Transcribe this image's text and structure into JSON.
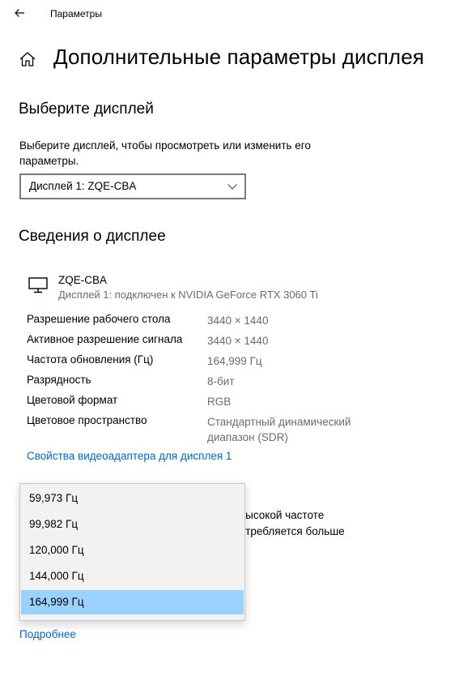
{
  "window": {
    "title": "Параметры"
  },
  "page": {
    "title": "Дополнительные параметры дисплея"
  },
  "select_display": {
    "heading": "Выберите дисплей",
    "description_line1": "Выберите дисплей, чтобы просмотреть или изменить его",
    "description_line2": "параметры.",
    "dropdown_value": "Дисплей 1: ZQE-CBA"
  },
  "display_info": {
    "heading": "Сведения о дисплее",
    "name": "ZQE-CBA",
    "connection": "Дисплей 1: подключен к NVIDIA GeForce RTX 3060 Ti",
    "rows": [
      {
        "label": "Разрешение рабочего стола",
        "value": "3440 × 1440"
      },
      {
        "label": "Активное разрешение сигнала",
        "value": "3440 × 1440"
      },
      {
        "label": "Частота обновления (Гц)",
        "value": "164,999 Гц"
      },
      {
        "label": "Разрядность",
        "value": "8-бит"
      },
      {
        "label": "Цветовой формат",
        "value": "RGB"
      },
      {
        "label": "Цветовое пространство",
        "value_line1": "Стандартный динамический",
        "value_line2": "диапазон (SDR)"
      }
    ],
    "adapter_link": "Свойства видеоадаптера для дисплея 1"
  },
  "refresh_rate": {
    "hidden_text_line1": "высокой частоте",
    "hidden_text_line2": "отребляется больше",
    "options": [
      "59,973 Гц",
      "99,982 Гц",
      "120,000 Гц",
      "144,000 Гц",
      "164,999 Гц"
    ],
    "selected": "164,999 Гц",
    "more_link": "Подробнее"
  },
  "icons": {
    "back": "back-arrow-icon",
    "home": "home-icon",
    "monitor": "monitor-icon",
    "chevron": "chevron-down-icon"
  },
  "colors": {
    "link": "#0067c0",
    "selected_option": "#99d1ff",
    "secondary_text": "#6b6b6b"
  }
}
